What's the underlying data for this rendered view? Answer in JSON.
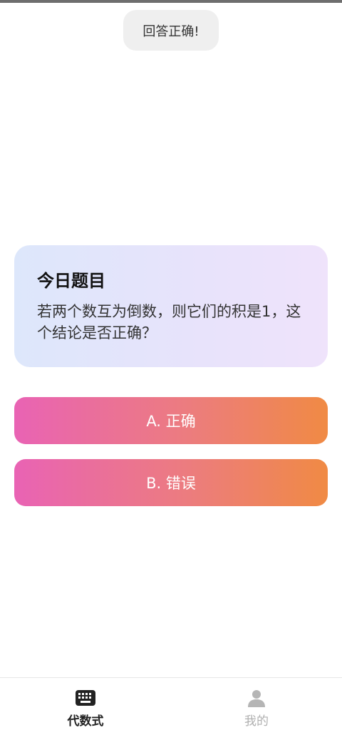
{
  "toast": {
    "text": "回答正确!"
  },
  "question_card": {
    "title": "今日题目",
    "question": "若两个数互为倒数，则它们的积是1，这个结论是否正确？"
  },
  "options": [
    {
      "label": "A. 正确"
    },
    {
      "label": "B. 错误"
    }
  ],
  "tabbar": {
    "tabs": [
      {
        "label": "代数式",
        "icon": "keyboard-icon",
        "active": true
      },
      {
        "label": "我的",
        "icon": "person-icon",
        "active": false
      }
    ]
  },
  "colors": {
    "option_gradient_start": "#e963b4",
    "option_gradient_end": "#f08a44",
    "card_gradient_start": "#dde7fb",
    "card_gradient_end": "#efe3fb"
  }
}
